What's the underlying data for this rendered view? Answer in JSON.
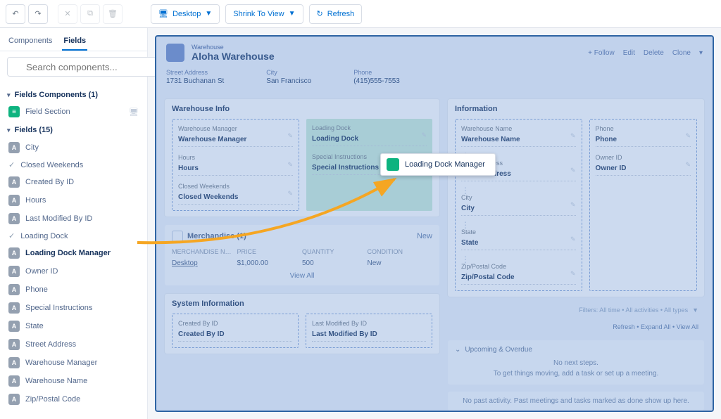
{
  "toolbar": {
    "device": "Desktop",
    "zoom": "Shrink To View",
    "refresh": "Refresh"
  },
  "sidebar": {
    "tabs": {
      "components": "Components",
      "fields": "Fields"
    },
    "search_placeholder": "Search components...",
    "section_components": {
      "title": "Fields Components (1)",
      "item": "Field Section"
    },
    "section_fields_title": "Fields (15)",
    "fields": [
      {
        "label": "City",
        "type": "A",
        "checked": false
      },
      {
        "label": "Closed Weekends",
        "type": "check",
        "checked": true
      },
      {
        "label": "Created By ID",
        "type": "A",
        "checked": false
      },
      {
        "label": "Hours",
        "type": "A",
        "checked": false
      },
      {
        "label": "Last Modified By ID",
        "type": "A",
        "checked": false
      },
      {
        "label": "Loading Dock",
        "type": "check",
        "checked": true
      },
      {
        "label": "Loading Dock Manager",
        "type": "A",
        "checked": false,
        "highlight": true
      },
      {
        "label": "Owner ID",
        "type": "A",
        "checked": false
      },
      {
        "label": "Phone",
        "type": "A",
        "checked": false
      },
      {
        "label": "Special Instructions",
        "type": "A",
        "checked": false
      },
      {
        "label": "State",
        "type": "A",
        "checked": false
      },
      {
        "label": "Street Address",
        "type": "A",
        "checked": false
      },
      {
        "label": "Warehouse Manager",
        "type": "A",
        "checked": false
      },
      {
        "label": "Warehouse Name",
        "type": "A",
        "checked": false
      },
      {
        "label": "Zip/Postal Code",
        "type": "A",
        "checked": false
      }
    ]
  },
  "record": {
    "object": "Warehouse",
    "name": "Aloha Warehouse",
    "actions": {
      "follow": "+  Follow",
      "edit": "Edit",
      "delete": "Delete",
      "clone": "Clone"
    },
    "header_fields": [
      {
        "label": "Street Address",
        "value": "1731 Buchanan St"
      },
      {
        "label": "City",
        "value": "San Francisco"
      },
      {
        "label": "Phone",
        "value": "(415)555-7553"
      }
    ]
  },
  "warehouse_info": {
    "title": "Warehouse Info",
    "left": [
      {
        "label": "Warehouse Manager",
        "value": "Warehouse Manager"
      },
      {
        "label": "Hours",
        "value": "Hours"
      },
      {
        "label": "Closed Weekends",
        "value": "Closed Weekends"
      }
    ],
    "right": [
      {
        "label": "Loading Dock",
        "value": "Loading Dock"
      },
      {
        "label": "Special Instructions",
        "value": "Special Instructions"
      }
    ]
  },
  "merchandise": {
    "title": "Merchandise (1)",
    "new": "New",
    "cols": [
      "MERCHANDISE N…",
      "PRICE",
      "QUANTITY",
      "CONDITION"
    ],
    "row": [
      "Desktop",
      "$1,000.00",
      "500",
      "New"
    ],
    "viewall": "View All"
  },
  "system_info": {
    "title": "System Information",
    "left": {
      "label": "Created By ID",
      "value": "Created By ID"
    },
    "right": {
      "label": "Last Modified By ID",
      "value": "Last Modified By ID"
    }
  },
  "information": {
    "title": "Information",
    "left": [
      {
        "label": "Warehouse Name",
        "value": "Warehouse Name"
      },
      {
        "label": "Street Address",
        "value": "Street Address"
      },
      {
        "label": "City",
        "value": "City"
      },
      {
        "label": "State",
        "value": "State"
      },
      {
        "label": "Zip/Postal Code",
        "value": "Zip/Postal Code"
      }
    ],
    "right": [
      {
        "label": "Phone",
        "value": "Phone"
      },
      {
        "label": "Owner ID",
        "value": "Owner ID"
      }
    ]
  },
  "activities": {
    "filters": "Filters: All time • All activities • All types",
    "links": "Refresh • Expand All • View All",
    "upcoming": "Upcoming & Overdue",
    "empty1": "No next steps.",
    "empty2": "To get things moving, add a task or set up a meeting.",
    "past": "No past activity. Past meetings and tasks marked as done show up here."
  },
  "drag_ghost": "Loading Dock Manager"
}
